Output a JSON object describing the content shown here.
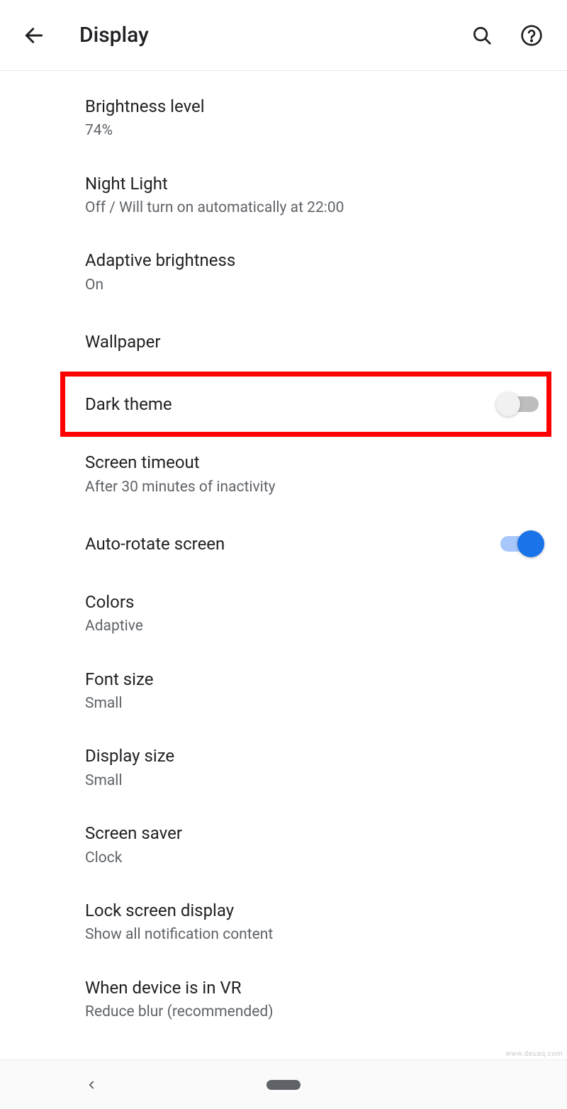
{
  "header": {
    "title": "Display"
  },
  "settings": [
    {
      "id": "brightness-level",
      "title": "Brightness level",
      "subtitle": "74%",
      "toggle": null
    },
    {
      "id": "night-light",
      "title": "Night Light",
      "subtitle": "Off / Will turn on automatically at 22:00",
      "toggle": null
    },
    {
      "id": "adaptive-brightness",
      "title": "Adaptive brightness",
      "subtitle": "On",
      "toggle": null
    },
    {
      "id": "wallpaper",
      "title": "Wallpaper",
      "subtitle": null,
      "toggle": null
    },
    {
      "id": "dark-theme",
      "title": "Dark theme",
      "subtitle": null,
      "toggle": "off",
      "highlighted": true
    },
    {
      "id": "screen-timeout",
      "title": "Screen timeout",
      "subtitle": "After 30 minutes of inactivity",
      "toggle": null
    },
    {
      "id": "auto-rotate",
      "title": "Auto-rotate screen",
      "subtitle": null,
      "toggle": "on"
    },
    {
      "id": "colors",
      "title": "Colors",
      "subtitle": "Adaptive",
      "toggle": null
    },
    {
      "id": "font-size",
      "title": "Font size",
      "subtitle": "Small",
      "toggle": null
    },
    {
      "id": "display-size",
      "title": "Display size",
      "subtitle": "Small",
      "toggle": null
    },
    {
      "id": "screen-saver",
      "title": "Screen saver",
      "subtitle": "Clock",
      "toggle": null
    },
    {
      "id": "lock-screen-display",
      "title": "Lock screen display",
      "subtitle": "Show all notification content",
      "toggle": null
    },
    {
      "id": "vr-mode",
      "title": "When device is in VR",
      "subtitle": "Reduce blur (recommended)",
      "toggle": null
    }
  ],
  "watermark": "www.deuaq.com"
}
